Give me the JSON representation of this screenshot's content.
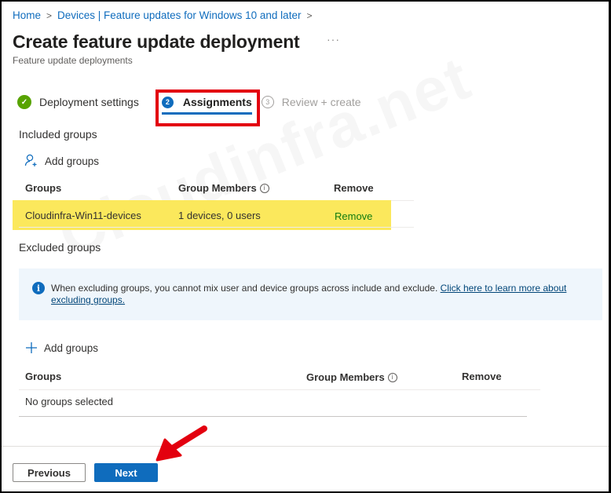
{
  "breadcrumb": {
    "items": [
      "Home",
      "Devices | Feature updates for Windows 10 and later"
    ],
    "separator": ">"
  },
  "header": {
    "title": "Create feature update deployment",
    "more_label": "···",
    "subtitle": "Feature update deployments"
  },
  "wizard": {
    "steps": [
      {
        "number": "✓",
        "label": "Deployment settings",
        "state": "completed"
      },
      {
        "number": "2",
        "label": "Assignments",
        "state": "active"
      },
      {
        "number": "3",
        "label": "Review + create",
        "state": "pending"
      }
    ]
  },
  "included": {
    "section_label": "Included groups",
    "add_label": "Add groups",
    "columns": [
      "Groups",
      "Group Members",
      "Remove"
    ],
    "info_glyph": "i",
    "rows": [
      {
        "group": "Cloudinfra-Win11-devices",
        "members": "1 devices, 0 users",
        "action": "Remove"
      }
    ]
  },
  "excluded": {
    "section_label": "Excluded groups",
    "info": {
      "icon": "info-icon",
      "text": "When excluding groups, you cannot mix user and device groups across include and exclude. ",
      "link_text": "Click here to learn more about excluding groups."
    },
    "add_label": "Add groups",
    "columns": [
      "Groups",
      "Group Members",
      "Remove"
    ],
    "info_glyph": "i",
    "empty_text": "No groups selected"
  },
  "footer": {
    "previous_label": "Previous",
    "next_label": "Next"
  },
  "watermark": "Cloudinfra.net",
  "colors": {
    "accent": "#0f6cbd",
    "success": "#57a300",
    "highlight": "#fbe85c",
    "annotation": "#e3000f",
    "remove_link": "#107c10"
  }
}
